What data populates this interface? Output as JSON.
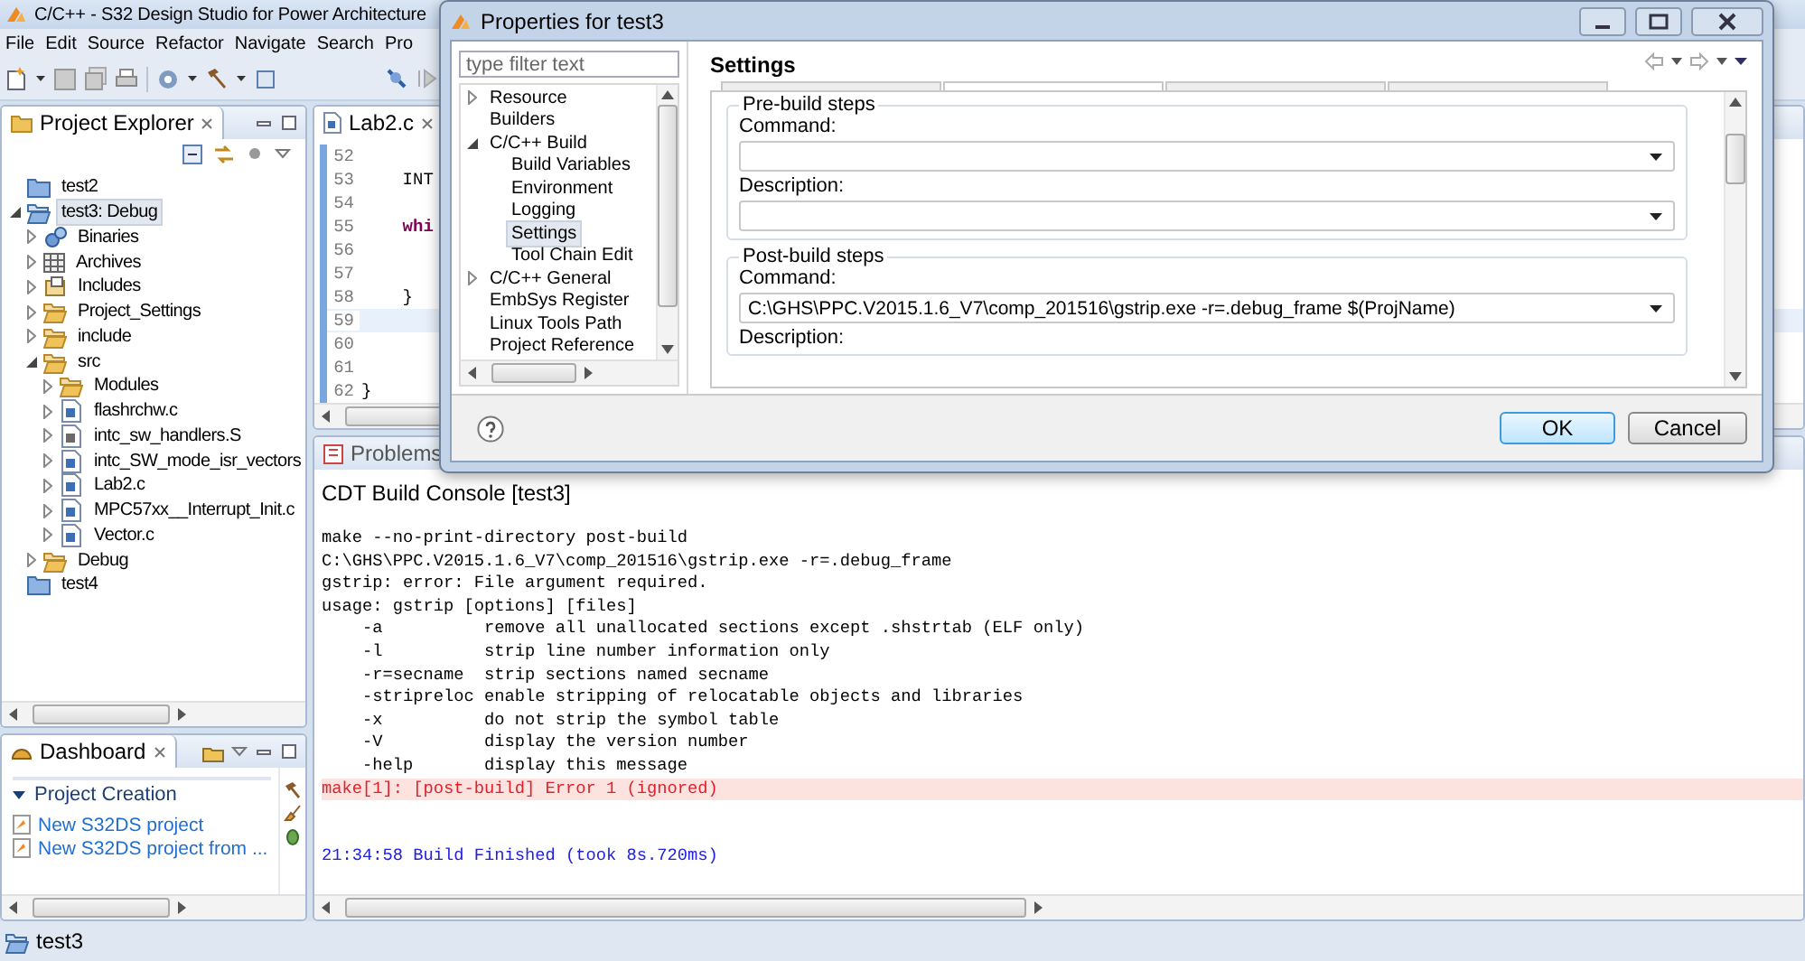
{
  "app": {
    "title": "C/C++ - S32 Design Studio for Power Architecture",
    "menu": [
      "File",
      "Edit",
      "Source",
      "Refactor",
      "Navigate",
      "Search",
      "Pro"
    ]
  },
  "explorer": {
    "title": "Project Explorer",
    "tree": [
      {
        "label": "test2",
        "kind": "closed-project",
        "selected": false
      },
      {
        "label": "test3: Debug",
        "kind": "open-project",
        "expanded": true,
        "selected": true,
        "children": [
          {
            "label": "Binaries",
            "kind": "binaries",
            "expanded": false,
            "selected": false
          },
          {
            "label": "Archives",
            "kind": "archives",
            "expanded": false,
            "selected": false
          },
          {
            "label": "Includes",
            "kind": "includes",
            "expanded": false,
            "selected": false
          },
          {
            "label": "Project_Settings",
            "kind": "folder",
            "expanded": false,
            "selected": false
          },
          {
            "label": "include",
            "kind": "folder",
            "expanded": false,
            "selected": false
          },
          {
            "label": "src",
            "kind": "folder",
            "expanded": true,
            "selected": false,
            "children": [
              {
                "label": "Modules",
                "kind": "folder",
                "expanded": false,
                "selected": false
              },
              {
                "label": "flashrchw.c",
                "kind": "c-file",
                "expanded": false,
                "selected": false
              },
              {
                "label": "intc_sw_handlers.S",
                "kind": "asm-file",
                "expanded": false,
                "selected": false
              },
              {
                "label": "intc_SW_mode_isr_vectors",
                "kind": "c-file",
                "expanded": false,
                "selected": false
              },
              {
                "label": "Lab2.c",
                "kind": "c-file",
                "expanded": false,
                "selected": false
              },
              {
                "label": "MPC57xx__Interrupt_Init.c",
                "kind": "c-file",
                "expanded": false,
                "selected": false
              },
              {
                "label": "Vector.c",
                "kind": "c-file",
                "expanded": false,
                "selected": false
              }
            ]
          },
          {
            "label": "Debug",
            "kind": "folder",
            "expanded": false,
            "selected": false
          }
        ]
      },
      {
        "label": "test4",
        "kind": "closed-project",
        "selected": false
      }
    ]
  },
  "dashboard": {
    "title": "Dashboard",
    "section": {
      "title": "Project Creation",
      "expanded": true
    },
    "links": [
      "New S32DS project",
      "New S32DS project from ..."
    ]
  },
  "editor": {
    "tab": "Lab2.c",
    "lines": [
      {
        "number": "52",
        "kind": "plain",
        "selected": false
      },
      {
        "number": "53",
        "text": "    INT",
        "kind": "plain",
        "selected": false
      },
      {
        "number": "54",
        "kind": "plain",
        "selected": false
      },
      {
        "number": "55",
        "text": "    whi",
        "kind": "keyword",
        "selected": false
      },
      {
        "number": "56",
        "kind": "plain",
        "selected": false
      },
      {
        "number": "57",
        "kind": "plain",
        "selected": false
      },
      {
        "number": "58",
        "text": "    }",
        "kind": "plain",
        "selected": false
      },
      {
        "number": "59",
        "kind": "plain",
        "selected": true
      },
      {
        "number": "60",
        "kind": "plain",
        "selected": false
      },
      {
        "number": "61",
        "kind": "plain",
        "selected": false
      },
      {
        "number": "62",
        "text": "}",
        "kind": "plain",
        "selected": false
      }
    ]
  },
  "console": {
    "tabs": [
      {
        "label": "Problems",
        "selected": false
      }
    ],
    "title": "CDT Build Console [test3]",
    "lines": [
      {
        "text": "make --no-print-directory post-build",
        "kind": "output"
      },
      {
        "text": "C:\\GHS\\PPC.V2015.1.6_V7\\comp_201516\\gstrip.exe -r=.debug_frame",
        "kind": "output"
      },
      {
        "text": "gstrip: error: File argument required.",
        "kind": "output"
      },
      {
        "text": "usage: gstrip [options] [files]",
        "kind": "output"
      },
      {
        "text": "    -a          remove all unallocated sections except .shstrtab (ELF only)",
        "kind": "output"
      },
      {
        "text": "    -l          strip line number information only",
        "kind": "output"
      },
      {
        "text": "    -r=secname  strip sections named secname",
        "kind": "output"
      },
      {
        "text": "    -stripreloc enable stripping of relocatable objects and libraries",
        "kind": "output"
      },
      {
        "text": "    -x          do not strip the symbol table",
        "kind": "output"
      },
      {
        "text": "    -V          display the version number",
        "kind": "output"
      },
      {
        "text": "    -help       display this message",
        "kind": "output"
      },
      {
        "text": "make[1]: [post-build] Error 1 (ignored)",
        "kind": "error"
      },
      {
        "text": "21:34:58 Build Finished (took 8s.720ms)",
        "kind": "status"
      }
    ]
  },
  "status_bar": {
    "text": "test3"
  },
  "dialog": {
    "title": "Properties for test3",
    "filter": {
      "placeholder": "type filter text"
    },
    "tree": [
      {
        "label": "Resource",
        "expanded": false,
        "selected": false
      },
      {
        "label": "Builders",
        "selected": false
      },
      {
        "label": "C/C++ Build",
        "expanded": true,
        "selected": false,
        "children": [
          {
            "label": "Build Variables",
            "selected": false
          },
          {
            "label": "Environment",
            "selected": false
          },
          {
            "label": "Logging",
            "selected": false
          },
          {
            "label": "Settings",
            "selected": true
          },
          {
            "label": "Tool Chain Edit",
            "selected": false
          }
        ]
      },
      {
        "label": "C/C++ General",
        "expanded": false,
        "selected": false
      },
      {
        "label": "EmbSys Register",
        "selected": false
      },
      {
        "label": "Linux Tools Path",
        "selected": false
      },
      {
        "label": "Project Reference",
        "selected": false
      }
    ],
    "page_title": "Settings",
    "groups": [
      {
        "title": "Pre-build steps",
        "fields": [
          {
            "label": "Command:",
            "kind": "combo"
          },
          {
            "label": "Description:",
            "kind": "combo"
          }
        ]
      },
      {
        "title": "Post-build steps",
        "fields": [
          {
            "label": "Command:",
            "kind": "combo",
            "value": "C:\\GHS\\PPC.V2015.1.6_V7\\comp_201516\\gstrip.exe -r=.debug_frame $(ProjName)"
          },
          {
            "label": "Description:",
            "kind": "label"
          }
        ]
      }
    ],
    "buttons": [
      {
        "label": "OK",
        "default": true
      },
      {
        "label": "Cancel",
        "default": false
      }
    ]
  }
}
